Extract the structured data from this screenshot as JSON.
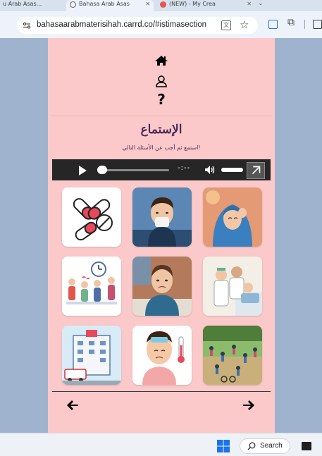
{
  "browser": {
    "tabs": [
      {
        "title": "u Arab Asas..."
      },
      {
        "title": "Bahasa Arab Asas"
      },
      {
        "title": "(NEW) - My Crea"
      }
    ],
    "url": "bahasaarabmaterisihah.carrd.co/#istimasection",
    "accent_color": "#1a73e8"
  },
  "page": {
    "background_color": "#fbc9c9",
    "nav": {
      "home_icon": "home-icon",
      "user_icon": "user-icon",
      "help_text": "?"
    },
    "title": "الإستماع",
    "instruction": "استمع ثم أجب عن الأسئلة التالي!",
    "audio": {
      "time": "-:--",
      "progress": 0,
      "volume": 0.85
    },
    "images": [
      {
        "subject": "pills"
      },
      {
        "subject": "boy-with-tissue"
      },
      {
        "subject": "woman-with-headache"
      },
      {
        "subject": "people-waiting-with-clock"
      },
      {
        "subject": "sick-boy-in-bed"
      },
      {
        "subject": "nurse-and-patient"
      },
      {
        "subject": "hospital-building"
      },
      {
        "subject": "fever-person-with-thermometer"
      },
      {
        "subject": "people-exercising-in-park"
      }
    ],
    "footer_nav": {
      "prev_icon": "arrow-left-icon",
      "next_icon": "arrow-right-icon"
    }
  },
  "taskbar": {
    "search_label": "Search"
  }
}
